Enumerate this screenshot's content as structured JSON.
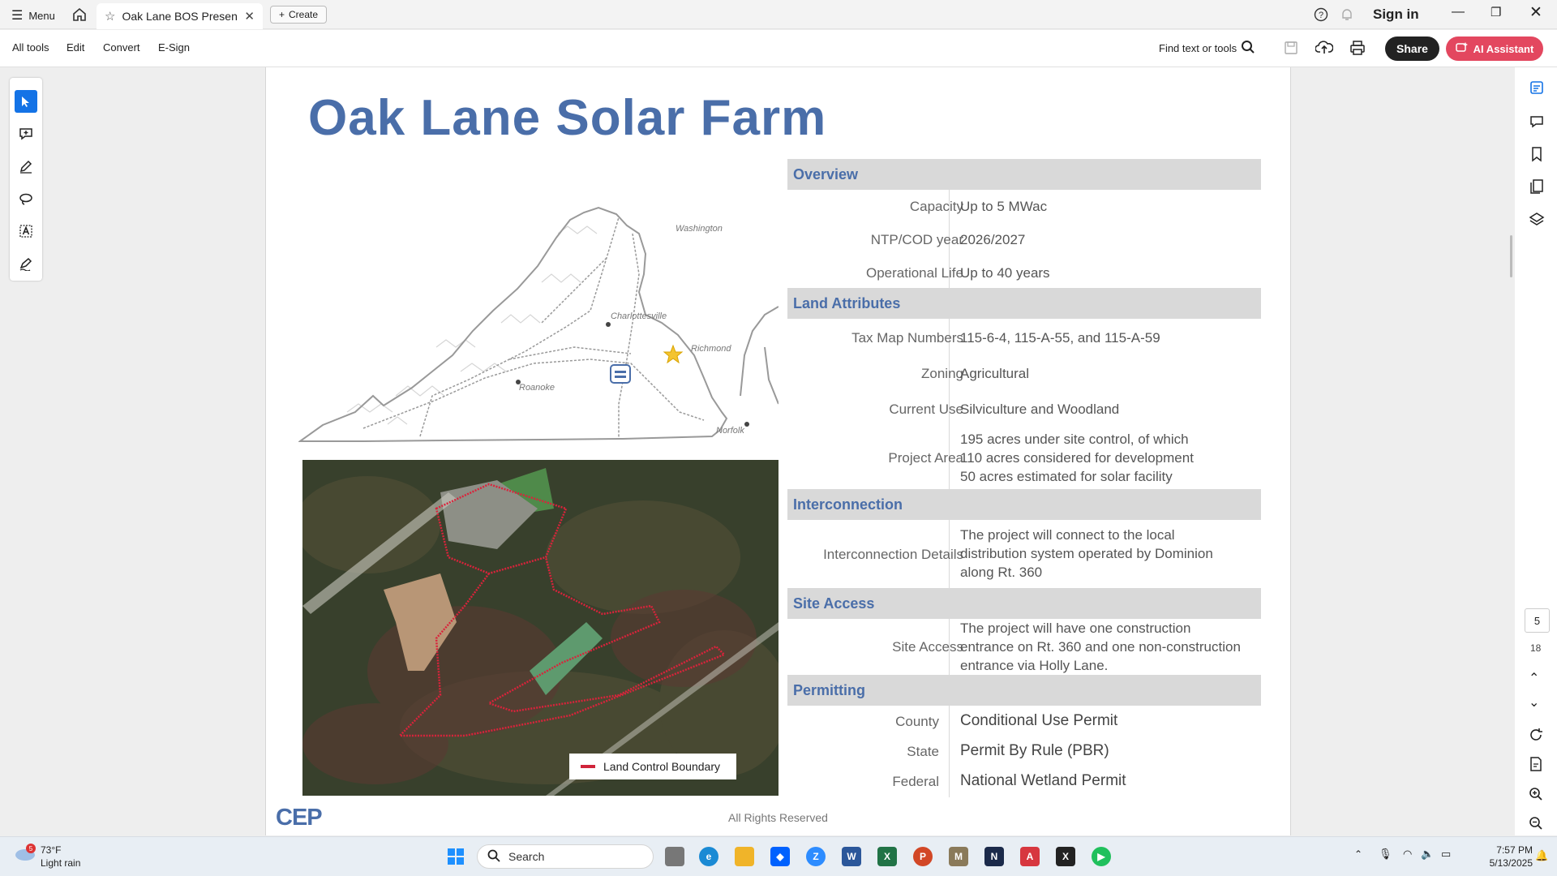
{
  "titlebar": {
    "menu_label": "Menu",
    "tab_title": "Oak Lane BOS Presenta...",
    "create_label": "Create",
    "signin_label": "Sign in"
  },
  "toolbar": {
    "menus": [
      "All tools",
      "Edit",
      "Convert",
      "E-Sign"
    ],
    "find_label": "Find text or tools",
    "share_label": "Share",
    "ai_label": "AI Assistant"
  },
  "document": {
    "title": "Oak Lane Solar Farm",
    "map_labels": {
      "washington": "Washington",
      "charlottesville": "Charlottesville",
      "richmond": "Richmond",
      "roanoke": "Roanoke",
      "norfolk": "Norfolk"
    },
    "legend_label": "Land Control Boundary",
    "sections": {
      "overview": {
        "heading": "Overview",
        "rows": [
          {
            "label": "Capacity",
            "value": "Up to 5 MWac"
          },
          {
            "label": "NTP/COD year",
            "value": "2026/2027"
          },
          {
            "label": "Operational Life",
            "value": "Up to 40 years"
          }
        ]
      },
      "land": {
        "heading": "Land Attributes",
        "rows": [
          {
            "label": "Tax Map Numbers",
            "value": "115-6-4, 115-A-55, and 115-A-59"
          },
          {
            "label": "Zoning",
            "value": "Agricultural"
          },
          {
            "label": "Current Use",
            "value": "Silviculture and Woodland"
          },
          {
            "label": "Project Area",
            "value_lines": [
              "195 acres under site control, of which",
              "110 acres considered for development",
              "50 acres estimated for solar facility"
            ]
          }
        ]
      },
      "interconnection": {
        "heading": "Interconnection",
        "rows": [
          {
            "label": "Interconnection Details",
            "value_lines": [
              "The project will connect to the local",
              "distribution system operated by Dominion",
              "along Rt. 360"
            ]
          }
        ]
      },
      "site_access": {
        "heading": "Site Access",
        "rows": [
          {
            "label": "Site Access",
            "value_lines": [
              "The project will have one construction",
              "entrance on Rt. 360 and one non-construction",
              "entrance via Holly Lane."
            ]
          }
        ]
      },
      "permitting": {
        "heading": "Permitting",
        "rows": [
          {
            "label": "County",
            "value": "Conditional Use Permit"
          },
          {
            "label": "State",
            "value": "Permit By Rule (PBR)"
          },
          {
            "label": "Federal",
            "value": "National Wetland Permit"
          }
        ]
      }
    },
    "logo_text": "CEP",
    "footer": "All Rights Reserved"
  },
  "nav": {
    "current_page": "5",
    "total_pages": "18"
  },
  "taskbar": {
    "weather_badge": "5",
    "weather_temp": "73°F",
    "weather_cond": "Light rain",
    "search_label": "Search",
    "apps": [
      "start",
      "task-view",
      "edge",
      "file-explorer",
      "dropbox",
      "zoom",
      "word",
      "excel",
      "powerpoint",
      "mpc",
      "ndi",
      "acrobat",
      "x",
      "media-player"
    ],
    "time": "7:57 PM",
    "date": "5/13/2025"
  },
  "colors": {
    "accent_blue": "#4a6ea9",
    "ai_button": "#e3475f",
    "section_bg": "#d9d9d9",
    "boundary_red": "#d0243a"
  }
}
